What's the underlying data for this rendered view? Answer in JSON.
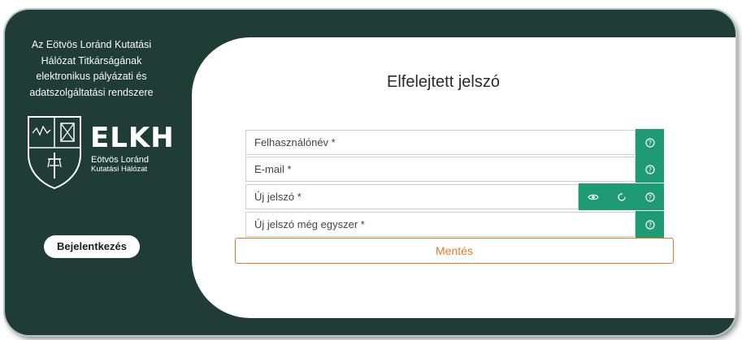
{
  "sidebar": {
    "org_lines": [
      "Az Eötvös Loránd Kutatási",
      "Hálózat Titkárságának",
      "elektronikus pályázati és",
      "adatszolgáltatási rendszere"
    ],
    "logo": {
      "mark": "ELKH",
      "sub1": "Eötvös Loránd",
      "sub2": "Kutatási Hálózat"
    },
    "login_label": "Bejelentkezés"
  },
  "form": {
    "title": "Elfelejtett jelszó",
    "username": {
      "placeholder": "Felhasználónév *",
      "value": ""
    },
    "email": {
      "placeholder": "E-mail *",
      "value": ""
    },
    "new_password": {
      "placeholder": "Új jelszó *",
      "value": ""
    },
    "new_password_again": {
      "placeholder": "Új jelszó még egyszer *",
      "value": ""
    },
    "save_label": "Mentés"
  },
  "icons": {
    "help": "question-circle-icon",
    "show_password": "eye-icon",
    "generate_password": "refresh-icon"
  },
  "colors": {
    "sidebar_bg": "#1f3d36",
    "accent_green": "#1e9b73",
    "save_orange": "#e07b2d"
  }
}
